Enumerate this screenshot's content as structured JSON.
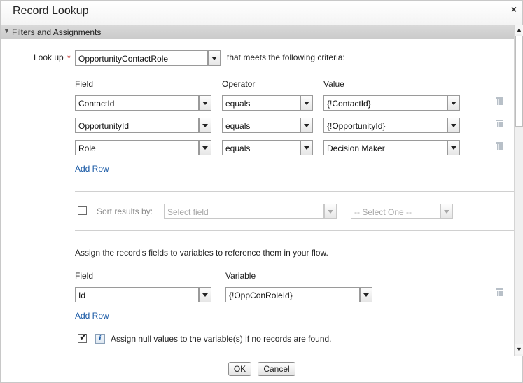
{
  "dialog": {
    "title": "Record Lookup",
    "close_glyph": "×",
    "section_title": "Filters and Assignments",
    "section_arrow": "▼"
  },
  "lookup": {
    "label": "Look up",
    "required_marker": "*",
    "object": "OpportunityContactRole",
    "suffix": "that meets the following criteria:"
  },
  "criteria": {
    "headers": {
      "field": "Field",
      "operator": "Operator",
      "value": "Value"
    },
    "rows": [
      {
        "field": "ContactId",
        "operator": "equals",
        "value": "{!ContactId}"
      },
      {
        "field": "OpportunityId",
        "operator": "equals",
        "value": "{!OpportunityId}"
      },
      {
        "field": "Role",
        "operator": "equals",
        "value": "Decision Maker"
      }
    ],
    "add_row": "Add Row"
  },
  "sort": {
    "label": "Sort results by:",
    "field_placeholder": "Select field",
    "order_placeholder": "-- Select One --",
    "checked": false
  },
  "assignments": {
    "description": "Assign the record's fields to variables to reference them in your flow.",
    "headers": {
      "field": "Field",
      "variable": "Variable"
    },
    "rows": [
      {
        "field": "Id",
        "variable": "{!OppConRoleId}"
      }
    ],
    "add_row": "Add Row",
    "null_values_label": "Assign null values to the variable(s) if no records are found.",
    "null_values_checked": true,
    "info_glyph": "i",
    "check_glyph": "✔"
  },
  "buttons": {
    "ok": "OK",
    "cancel": "Cancel"
  },
  "scroll": {
    "up": "▲",
    "down": "▼"
  },
  "colors": {
    "link": "#1a5aa6",
    "required": "#c23934",
    "section_bar": "#d2d2d2"
  },
  "icons": {
    "row_delete": "trash-icon",
    "help": "info-icon"
  }
}
